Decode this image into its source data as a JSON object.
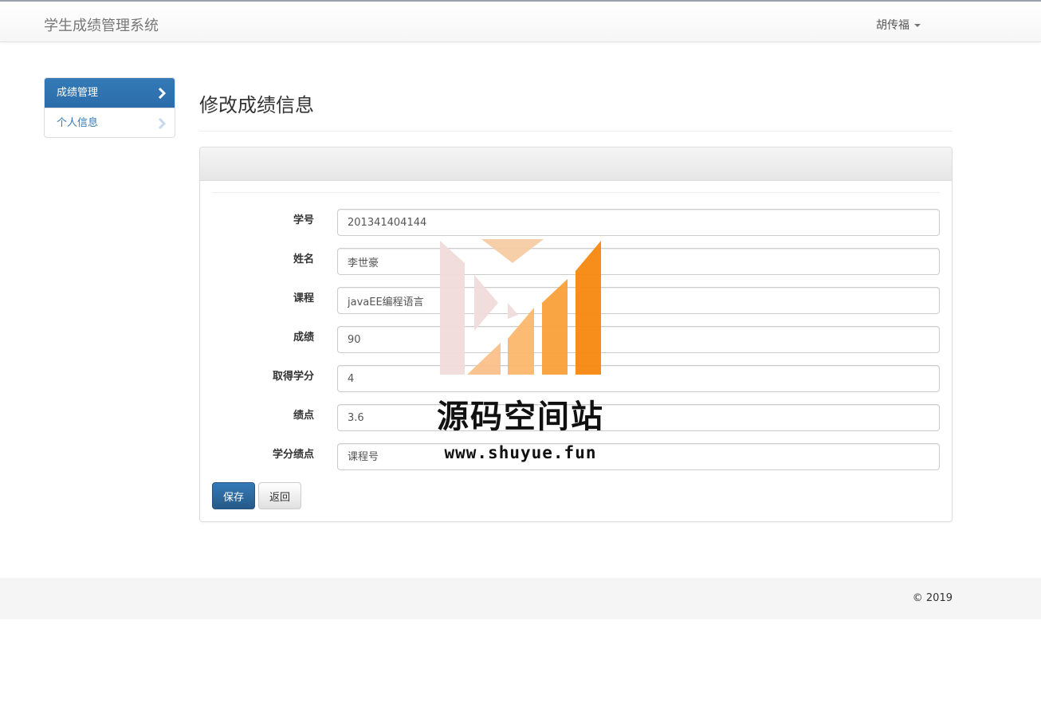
{
  "navbar": {
    "brand": "学生成绩管理系统",
    "user": "胡传福"
  },
  "sidebar": {
    "items": [
      {
        "label": "成绩管理",
        "active": true
      },
      {
        "label": "个人信息",
        "active": false
      }
    ]
  },
  "main": {
    "title": "修改成绩信息",
    "form": {
      "fields": [
        {
          "label": "学号",
          "value": "201341404144"
        },
        {
          "label": "姓名",
          "value": "李世豪"
        },
        {
          "label": "课程",
          "value": "javaEE编程语言"
        },
        {
          "label": "成绩",
          "value": "90"
        },
        {
          "label": "取得学分",
          "value": "4"
        },
        {
          "label": "绩点",
          "value": "3.6"
        },
        {
          "label": "学分绩点",
          "value": "",
          "placeholder": "课程号"
        }
      ],
      "save_label": "保存",
      "back_label": "返回"
    }
  },
  "footer": {
    "copyright": "© 2019"
  },
  "watermark": {
    "title": "源码空间站",
    "url": "www.shuyue.fun"
  },
  "colors": {
    "primary": "#337ab7",
    "logo_orange": "#f7880f",
    "logo_pink": "#f2dcdc"
  }
}
